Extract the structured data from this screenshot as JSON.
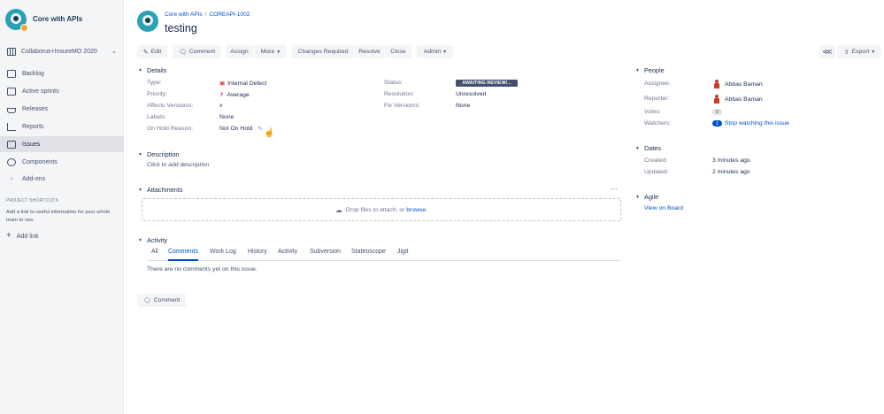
{
  "sidebar": {
    "project_name": "Core with APIs",
    "board_selector": "Collaborus+InsureMO 2020",
    "items": [
      {
        "label": "Backlog",
        "icon": "backlog-icon"
      },
      {
        "label": "Active sprints",
        "icon": "board-icon"
      },
      {
        "label": "Releases",
        "icon": "ship-icon"
      },
      {
        "label": "Reports",
        "icon": "chart-icon"
      },
      {
        "label": "Issues",
        "icon": "issues-icon",
        "active": true
      },
      {
        "label": "Components",
        "icon": "puzzle-icon"
      },
      {
        "label": "Add-ons",
        "icon": "chevron-right-icon"
      }
    ],
    "shortcuts_title": "PROJECT SHORTCUTS",
    "shortcuts_text": "Add a link to useful information for your whole team to see.",
    "add_link": "Add link"
  },
  "header": {
    "breadcrumb_project": "Core with APIs",
    "breadcrumb_sep": "/",
    "breadcrumb_key": "COREAPI-1002",
    "title": "testing"
  },
  "toolbar": {
    "edit": "Edit",
    "comment": "Comment",
    "assign": "Assign",
    "more": "More",
    "changes_required": "Changes Required",
    "resolve": "Resolve",
    "close": "Close",
    "admin": "Admin",
    "export": "Export"
  },
  "details": {
    "title": "Details",
    "type_label": "Type:",
    "type_value": "Internal Defect",
    "priority_label": "Priority:",
    "priority_value": "Average",
    "affects_label": "Affects Version/s:",
    "affects_value": "x",
    "labels_label": "Labels:",
    "labels_value": "None",
    "onhold_label": "On Hold Reason:",
    "onhold_value": "Not On Hold",
    "status_label": "Status:",
    "status_value": "AWAITING REVIEW/...",
    "resolution_label": "Resolution:",
    "resolution_value": "Unresolved",
    "fix_label": "Fix Version/s:",
    "fix_value": "None"
  },
  "description": {
    "title": "Description",
    "placeholder": "Click to add description"
  },
  "attachments": {
    "title": "Attachments",
    "more": "···",
    "drop_text": "Drop files to attach, or",
    "browse": "browse."
  },
  "activity": {
    "title": "Activity",
    "tabs": [
      "All",
      "Comments",
      "Work Log",
      "History",
      "Activity",
      "Subversion",
      "Stateoscope",
      "Jigit"
    ],
    "active_tab": "Comments",
    "empty": "There are no comments yet on this issue.",
    "comment_button": "Comment"
  },
  "people": {
    "title": "People",
    "assignee_label": "Assignee:",
    "assignee_value": "Abbas Baman",
    "reporter_label": "Reporter:",
    "reporter_value": "Abbas Baman",
    "votes_label": "Votes:",
    "votes_value": "0",
    "watchers_label": "Watchers:",
    "watchers_count": "1",
    "watchers_link": "Stop watching this issue"
  },
  "dates": {
    "title": "Dates",
    "created_label": "Created:",
    "created_value": "3 minutes ago",
    "updated_label": "Updated:",
    "updated_value": "2 minutes ago"
  },
  "agile": {
    "title": "Agile",
    "link": "View on Board"
  },
  "colors": {
    "accent": "#0052cc",
    "status_lozenge": "#42526e",
    "sidebar_bg": "#f4f5f7"
  }
}
